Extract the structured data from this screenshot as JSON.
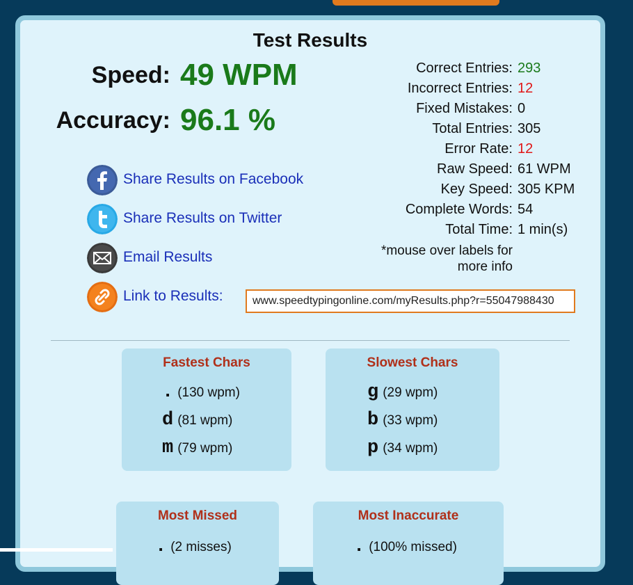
{
  "title": "Test Results",
  "speed": {
    "label": "Speed:",
    "value": "49 WPM"
  },
  "accuracy": {
    "label": "Accuracy:",
    "value": "96.1 %"
  },
  "stats": [
    {
      "label": "Correct Entries:",
      "value": "293",
      "color": "green"
    },
    {
      "label": "Incorrect Entries:",
      "value": "12",
      "color": "red"
    },
    {
      "label": "Fixed Mistakes:",
      "value": "0",
      "color": "normal"
    },
    {
      "label": "Total Entries:",
      "value": "305",
      "color": "normal"
    },
    {
      "label": "Error Rate:",
      "value": "12",
      "color": "red"
    },
    {
      "label": "Raw Speed:",
      "value": "61 WPM",
      "color": "normal"
    },
    {
      "label": "Key Speed:",
      "value": "305 KPM",
      "color": "normal"
    },
    {
      "label": "Complete Words:",
      "value": "54",
      "color": "normal"
    },
    {
      "label": "Total Time:",
      "value": "1 min(s)",
      "color": "normal"
    }
  ],
  "note_line1": "*mouse over labels for",
  "note_line2": "more info",
  "share": {
    "facebook": "Share Results on Facebook",
    "twitter": "Share Results on Twitter",
    "email": "Email Results",
    "link": "Link to Results:"
  },
  "results_url": "www.speedtypingonline.com/myResults.php?r=55047988430",
  "fastest": {
    "title": "Fastest Chars",
    "rows": [
      {
        "char": ".",
        "rate": "(130 wpm)"
      },
      {
        "char": "d",
        "rate": "(81 wpm)"
      },
      {
        "char": "m",
        "rate": "(79 wpm)"
      }
    ]
  },
  "slowest": {
    "title": "Slowest Chars",
    "rows": [
      {
        "char": "g",
        "rate": "(29 wpm)"
      },
      {
        "char": "b",
        "rate": "(33 wpm)"
      },
      {
        "char": "p",
        "rate": "(34 wpm)"
      }
    ]
  },
  "most_missed": {
    "title": "Most Missed",
    "first_rate": "(2 misses)",
    "first_char": "."
  },
  "most_inaccurate": {
    "title": "Most Inaccurate",
    "first_rate": "(100% missed)",
    "first_char": "."
  },
  "colors": {
    "green": "#1a7a1a",
    "red": "#e01818",
    "link": "#1a2fb8",
    "accent": "#e07a1e"
  },
  "icons": [
    "facebook-icon",
    "twitter-icon",
    "email-icon",
    "link-icon"
  ]
}
